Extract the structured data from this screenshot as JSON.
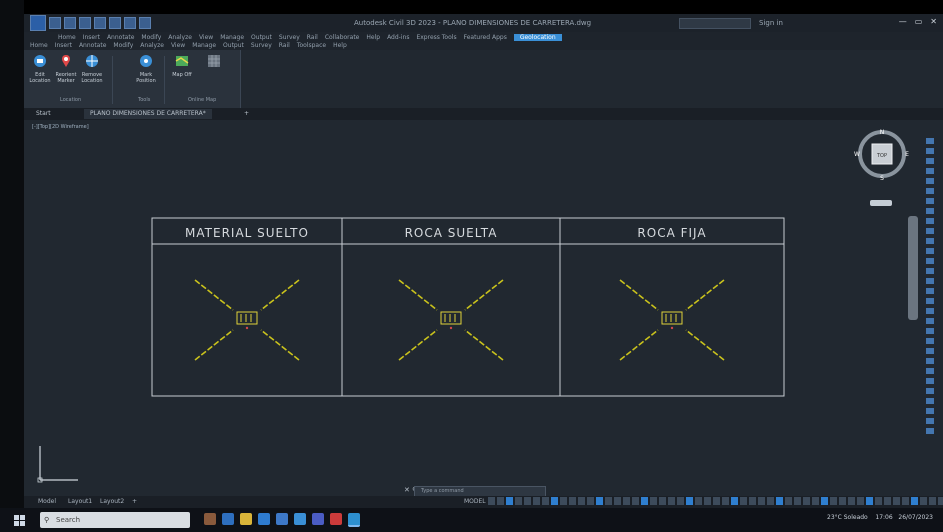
{
  "window": {
    "title": "Autodesk Civil 3D 2023 - PLANO DIMENSIONES DE CARRETERA.dwg",
    "sign_in": "Sign in",
    "controls": [
      "—",
      "▭",
      "✕"
    ]
  },
  "menu": {
    "row1": [
      "Home",
      "Insert",
      "Annotate",
      "Modify",
      "Analyze",
      "View",
      "Manage",
      "Output",
      "Survey",
      "Rail",
      "Collaborate",
      "Help",
      "Add-ins",
      "Express Tools",
      "Featured Apps",
      "Geolocation"
    ],
    "row2": [
      "Home",
      "Insert",
      "Annotate",
      "Modify",
      "Analyze",
      "View",
      "Manage",
      "Output",
      "Survey",
      "Rail",
      "Toolspace",
      "Help"
    ],
    "active_tab": "Geolocation"
  },
  "ribbon": {
    "buttons": [
      "Edit Location",
      "Reorient Marker",
      "Remove Location",
      "Mark Position",
      "Map Off"
    ],
    "groups": [
      "Location",
      "Tools",
      "Online Map"
    ]
  },
  "file_tabs": {
    "start": "Start",
    "active": "PLANO DIMENSIONES DE CARRETERA*",
    "add": "+"
  },
  "viewport_label": "[-][Top][2D Wireframe]",
  "viewcube": {
    "north": "N",
    "south": "S",
    "east": "E",
    "west": "W",
    "face": "TOP",
    "wcs": "WCS"
  },
  "drawing": {
    "headers": [
      "MATERIAL SUELTO",
      "ROCA SUELTA",
      "ROCA FIJA"
    ],
    "line_color": "#c9c21c",
    "border_color": "#c8cdd2",
    "marker_color": "#e0d23a"
  },
  "command_line": {
    "placeholder": "Type a command"
  },
  "layout_tabs": {
    "model": "Model",
    "layouts": [
      "Layout1",
      "Layout2",
      "+"
    ],
    "model_label": "MODEL"
  },
  "taskbar": {
    "search": "Search",
    "weather": "23°C Soleado",
    "time": "17:06",
    "date": "26/07/2023"
  },
  "colors": {
    "canvas": "#212830",
    "accent": "#3a8fd6"
  }
}
